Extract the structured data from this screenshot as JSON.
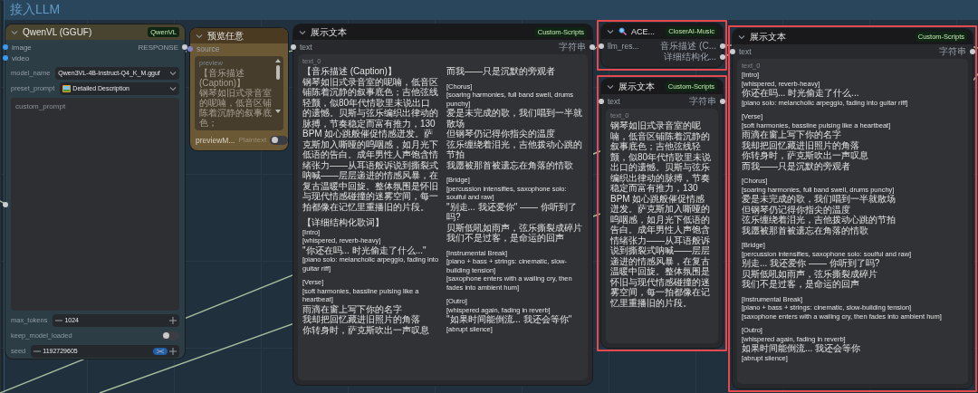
{
  "group": {
    "title": "接入LLM"
  },
  "qwenvl_node": {
    "title": "QwenVL (GGUF)",
    "badge": "QwenVL",
    "inputs": [
      {
        "label": "image"
      },
      {
        "label": "video"
      }
    ],
    "output": "RESPONSE",
    "model_name": {
      "label": "model_name",
      "value": "Qwen3VL-4B-Instruct-Q4_K_M.gguf"
    },
    "preset_prompt": {
      "label": "preset_prompt",
      "value": "Detailed Description"
    },
    "custom_prompt": {
      "placeholder": "custom_prompt"
    },
    "max_tokens": {
      "label": "max_tokens",
      "value": "1024"
    },
    "keep_model_loaded": {
      "label": "keep_model_loaded",
      "on": false
    },
    "seed": {
      "label": "seed",
      "value": "1192729605"
    }
  },
  "preview_node": {
    "title": "预览任意",
    "input": "source",
    "field_label": "preview",
    "preview_lines": [
      "【音乐描述 (Caption)】",
      "钢琴如旧式录音室的呢喃，低音区铺陈着沉静的叙事底色；"
    ],
    "mode_label": "previewM...",
    "mode_value": "Plaintext",
    "mode_on": false
  },
  "display_node_main": {
    "title": "展示文本",
    "badge": "Custom-Scripts",
    "input": "text",
    "output": "字符串",
    "field_label": "text_0",
    "lines": [
      {
        "kind": "line",
        "text": "【音乐描述 (Caption)】"
      },
      {
        "kind": "line",
        "text": "钢琴如旧式录音室的呢喃，低音区铺陈着沉静的叙事底色；吉他弦线轻颤，似80年代情歌里未说出口的遗憾。贝斯与弦乐编织出律动的脉搏，节奏稳定而富有推力，130 BPM 如心跳般催促情感迸发。萨克斯加入嘶哑的呜咽感，如月光下低语的告白。成年男性人声饱含情绪张力——从耳语般诉说到撕裂式呐喊——层层递进的情感风暴，在复古温暖中回旋。整体氛围是怀旧与现代情感碰撞的迷雾空间，每一拍都像在记忆里重播旧的片段。"
      },
      {
        "kind": "gap"
      },
      {
        "kind": "line",
        "text": "【详细结构化歌词】"
      },
      {
        "kind": "cue",
        "text": "[Intro]"
      },
      {
        "kind": "cue",
        "text": "[whispered, reverb-heavy]"
      },
      {
        "kind": "line",
        "text": "\"你还在吗... 时光偷走了什么...\""
      },
      {
        "kind": "cue",
        "text": "[piano solo: melancholic arpeggio, fading into guitar riff]"
      },
      {
        "kind": "gap"
      },
      {
        "kind": "cue",
        "text": "[Verse]"
      },
      {
        "kind": "cue",
        "text": "[soft harmonies, bassline pulsing like a heartbeat]"
      },
      {
        "kind": "line",
        "text": "雨滴在窗上写下你的名字"
      },
      {
        "kind": "line",
        "text": "我却把回忆藏进旧照片的角落"
      },
      {
        "kind": "line",
        "text": "你转身时，萨克斯吹出一声叹息"
      },
      {
        "kind": "line",
        "text": "而我——只是沉默的旁观者"
      },
      {
        "kind": "gap"
      },
      {
        "kind": "cue",
        "text": "[Chorus]"
      },
      {
        "kind": "cue",
        "text": "[soaring harmonies, full band swell, drums punchy]"
      },
      {
        "kind": "line",
        "text": "爱是未完成的歌，我们唱到一半就散场"
      },
      {
        "kind": "line",
        "text": "但钢琴仍记得你指尖的温度"
      },
      {
        "kind": "line",
        "text": "弦乐缠绕着泪光，吉他拨动心跳的节拍"
      },
      {
        "kind": "line",
        "text": "我愿被那首被遗忘在角落的情歌"
      },
      {
        "kind": "gap"
      },
      {
        "kind": "cue",
        "text": "[Bridge]"
      },
      {
        "kind": "cue",
        "text": "[percussion intensifies, saxophone solo: soulful and raw]"
      },
      {
        "kind": "line",
        "text": "\"别走... 我还爱你\" —— 你听到了吗?"
      },
      {
        "kind": "line",
        "text": "贝斯低吼如雨声，弦乐撕裂成碎片"
      },
      {
        "kind": "line",
        "text": "我们不是过客，是命运的回声"
      },
      {
        "kind": "gap"
      },
      {
        "kind": "cue",
        "text": "[Instrumental Break]"
      },
      {
        "kind": "cue",
        "text": "[piano + bass + strings: cinematic, slow-building tension]"
      },
      {
        "kind": "cue",
        "text": "[saxophone enters with a wailing cry, then fades into ambient hum]"
      },
      {
        "kind": "gap"
      },
      {
        "kind": "cue",
        "text": "[Outro]"
      },
      {
        "kind": "cue",
        "text": "[whispered again, fading in reverb]"
      },
      {
        "kind": "line",
        "text": "\"如果时间能倒流... 我还会等你\""
      },
      {
        "kind": "cue",
        "text": "[abrupt silence]"
      }
    ]
  },
  "music_node": {
    "title": "ACE...",
    "badge": "CloserAI-Music",
    "input": "llm_res...",
    "outputs": [
      "音乐描述 (C...",
      "详细结构化..."
    ]
  },
  "display_node_caption": {
    "title": "展示文本",
    "badge": "Custom-Scripts",
    "input": "text",
    "output": "字符串",
    "field_label": "text_0",
    "lines": [
      {
        "kind": "line",
        "text": "钢琴如旧式录音室的呢喃，低音区铺陈着沉静的叙事底色；吉他弦线轻颤，似80年代情歌里未说出口的遗憾。贝斯与弦乐编织出律动的脉搏，节奏稳定而富有推力，130 BPM 如心跳般催促情感迸发。萨克斯加入嘶哑的呜咽感，如月光下低语的告白。成年男性人声饱含情绪张力——从耳语般诉说到撕裂式呐喊——层层递进的情感风暴，在复古温暖中回旋。整体氛围是怀旧与现代情感碰撞的迷雾空间，每一拍都像在记忆里重播旧的片段。"
      }
    ]
  },
  "display_node_lyrics": {
    "title": "展示文本",
    "badge": "Custom-Scripts",
    "input": "text",
    "output": "字符串",
    "field_label": "text_0",
    "lines": [
      {
        "kind": "cue",
        "text": "[Intro]"
      },
      {
        "kind": "cue",
        "text": "[whispered, reverb-heavy]"
      },
      {
        "kind": "line",
        "text": "你还在吗... 时光偷走了什么..."
      },
      {
        "kind": "cue",
        "text": "[piano solo: melancholic arpeggio, fading into guitar riff]"
      },
      {
        "kind": "gap"
      },
      {
        "kind": "cue",
        "text": "[Verse]"
      },
      {
        "kind": "cue",
        "text": "[soft harmonies, bassline pulsing like a heartbeat]"
      },
      {
        "kind": "line",
        "text": "雨滴在窗上写下你的名字"
      },
      {
        "kind": "line",
        "text": "我却把回忆藏进旧照片的角落"
      },
      {
        "kind": "line",
        "text": "你转身时，萨克斯吹出一声叹息"
      },
      {
        "kind": "line",
        "text": "而我——只是沉默的旁观者"
      },
      {
        "kind": "gap"
      },
      {
        "kind": "cue",
        "text": "[Chorus]"
      },
      {
        "kind": "cue",
        "text": "[soaring harmonies, full band swell, drums punchy]"
      },
      {
        "kind": "line",
        "text": "爱是未完成的歌，我们唱到一半就散场"
      },
      {
        "kind": "line",
        "text": "但钢琴仍记得你指尖的温度"
      },
      {
        "kind": "line",
        "text": "弦乐缠绕着泪光，吉他拨动心跳的节拍"
      },
      {
        "kind": "line",
        "text": "我愿被那首被遗忘在角落的情歌"
      },
      {
        "kind": "gap"
      },
      {
        "kind": "cue",
        "text": "[Bridge]"
      },
      {
        "kind": "cue",
        "text": "[percussion intensifies, saxophone solo: soulful and raw]"
      },
      {
        "kind": "line",
        "text": "别走... 我还爱你 —— 你听到了吗?"
      },
      {
        "kind": "line",
        "text": "贝斯低吼如雨声，弦乐撕裂成碎片"
      },
      {
        "kind": "line",
        "text": "我们不是过客，是命运的回声"
      },
      {
        "kind": "gap"
      },
      {
        "kind": "cue",
        "text": "[Instrumental Break]"
      },
      {
        "kind": "cue",
        "text": "[piano + bass + strings: cinematic, slow-building tension]"
      },
      {
        "kind": "cue",
        "text": "[saxophone enters with a wailing cry, then fades into ambient hum]"
      },
      {
        "kind": "gap"
      },
      {
        "kind": "cue",
        "text": "[Outro]"
      },
      {
        "kind": "cue",
        "text": "[whispered again, fading in reverb]"
      },
      {
        "kind": "line",
        "text": "如果时间能倒流... 我还会等你"
      },
      {
        "kind": "cue",
        "text": "[abrupt silence]"
      }
    ]
  }
}
